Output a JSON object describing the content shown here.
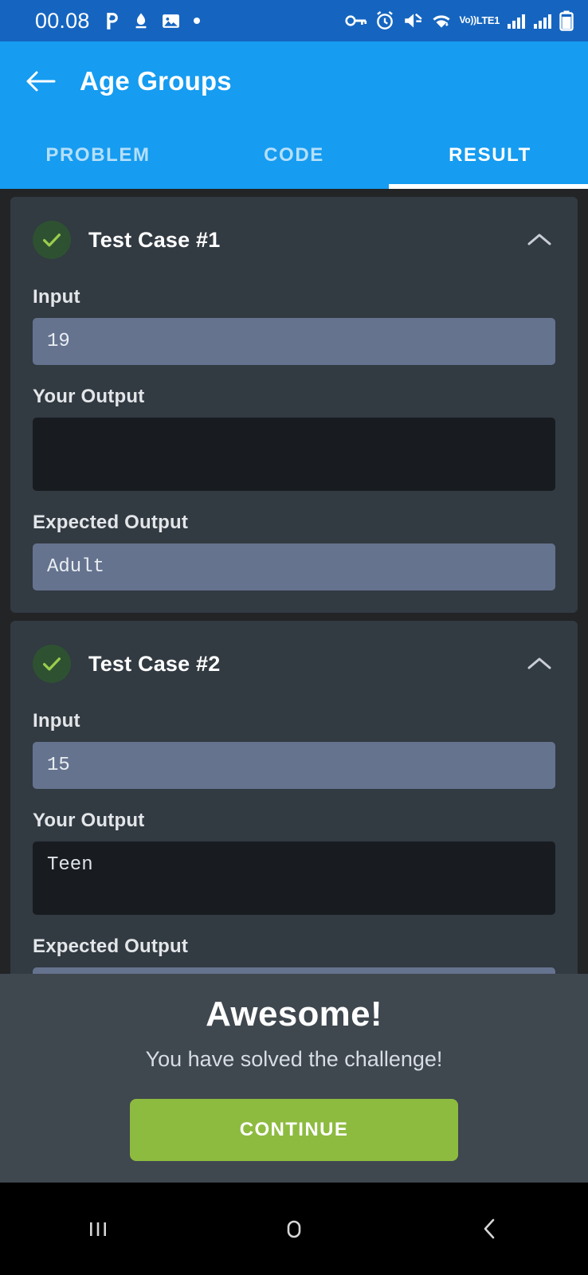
{
  "status_bar": {
    "clock": "00.08",
    "left_icons": [
      "app-badge-icon",
      "download-manager-icon",
      "gallery-icon",
      "dot-icon"
    ],
    "right_icons": [
      "vpn-key-icon",
      "alarm-icon",
      "mute-icon",
      "wifi-icon",
      "volte-icon",
      "signal-bars-1-icon",
      "signal-bars-2-icon",
      "battery-icon"
    ],
    "volte_line1": "Vo))",
    "volte_line2": "LTE1",
    "background_color": "#1565c0"
  },
  "appbar": {
    "back_icon": "arrow-back-icon",
    "title": "Age Groups",
    "background_color": "#169cf0",
    "tabs": [
      {
        "label": "PROBLEM",
        "active": false
      },
      {
        "label": "CODE",
        "active": false
      },
      {
        "label": "RESULT",
        "active": true
      }
    ]
  },
  "results": {
    "labels": {
      "input": "Input",
      "your_output": "Your Output",
      "expected_output": "Expected Output"
    },
    "test_cases": [
      {
        "title": "Test Case #1",
        "status": "passed",
        "status_icon": "check-icon",
        "expand_icon": "chevron-up-icon",
        "input": "19",
        "your_output": "",
        "expected_output": "Adult"
      },
      {
        "title": "Test Case #2",
        "status": "passed",
        "status_icon": "check-icon",
        "expand_icon": "chevron-up-icon",
        "input": "15",
        "your_output": "Teen",
        "expected_output": ""
      }
    ]
  },
  "sheet": {
    "title": "Awesome!",
    "subtitle": "You have solved the challenge!",
    "button_label": "CONTINUE",
    "button_color": "#8dbb40",
    "background_color": "#3f474f"
  },
  "navbar": {
    "recents_icon": "recents-icon",
    "home_icon": "home-icon",
    "back_icon": "nav-back-icon"
  },
  "colors": {
    "page_background": "#222426",
    "card_background": "#323a42",
    "field_filled": "#65738f",
    "field_output": "#181c20",
    "accent_blue": "#169cf0",
    "accent_green": "#8dbb40"
  }
}
